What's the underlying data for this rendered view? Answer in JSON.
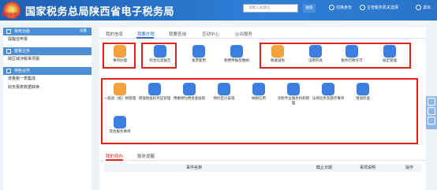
{
  "header": {
    "emblem_text": "陕西税务",
    "title": "国家税务总局陕西省电子税务局",
    "search_placeholder": "请输入关键词",
    "search_button": "搜索",
    "links": [
      "切换身份",
      "主管税务机关选择",
      "退出"
    ]
  },
  "sidebar": {
    "sections": [
      {
        "title": "常用功能",
        "extra": "设置",
        "items": [
          "提醒信申报"
        ]
      },
      {
        "title": "套餐业务",
        "items": [
          "跨区域涉税事项报"
        ]
      },
      {
        "title": "特色业务",
        "items": [
          "增量税一表集成",
          "财务报表数据转换"
        ]
      }
    ]
  },
  "tabs": [
    "我的信息",
    "我要办税",
    "我要查询",
    "互动中心",
    "公众服务"
  ],
  "active_tab": "我要办税",
  "tiles": [
    {
      "label": "事项办理",
      "color": "#f0a23b"
    },
    {
      "label": "综合信息报告",
      "color": "#3d7fe0"
    },
    {
      "label": "发票使用",
      "color": "#3d7fe0"
    },
    {
      "label": "税费申报及缴纳",
      "color": "#3d7fe0"
    },
    {
      "label": "税收减免",
      "color": "#f0a23b"
    },
    {
      "label": "证明开具",
      "color": "#3d7fe0"
    },
    {
      "label": "税务行政许可",
      "color": "#3d7fe0"
    },
    {
      "label": "核定管理",
      "color": "#3d7fe0"
    },
    {
      "label": "一般退（抵）税管理",
      "color": "#f0a23b"
    },
    {
      "label": "增值税抵扣凭证管理",
      "color": "#3d7fe0"
    },
    {
      "label": "预缴保险费资金收取",
      "color": "#3d7fe0"
    },
    {
      "label": "预约定价安排",
      "color": "#3d7fe0"
    },
    {
      "label": "纳税信用",
      "color": "#3d7fe0"
    },
    {
      "label": "涉税专业服务机构管理",
      "color": "#3d7fe0"
    },
    {
      "label": "法律追责及救济事项",
      "color": "#3d7fe0"
    },
    {
      "label": "增值检查",
      "color": "#3d7fe0"
    },
    {
      "label": "其他服务事项",
      "color": "#3d7fe0"
    }
  ],
  "bottom_tabs": [
    "我的待办",
    "服务提醒"
  ],
  "table_headers": [
    "事件名称",
    "截止日期",
    "事项说明",
    "操作"
  ]
}
